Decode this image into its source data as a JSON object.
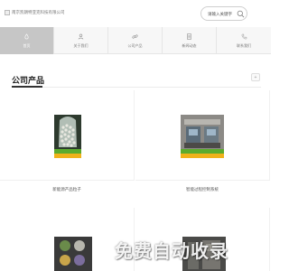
{
  "header": {
    "logo_text": "南京凯朗特亚克科技有限公司",
    "search": {
      "placeholder": "请输入关键字",
      "value": "请输入关键字"
    }
  },
  "nav": {
    "items": [
      {
        "label": "首页",
        "icon": "home-icon",
        "active": true
      },
      {
        "label": "关于我们",
        "icon": "user-icon",
        "active": false
      },
      {
        "label": "公司产品",
        "icon": "link-icon",
        "active": false
      },
      {
        "label": "新闻动态",
        "icon": "document-icon",
        "active": false
      },
      {
        "label": "联系我们",
        "icon": "phone-icon",
        "active": false
      }
    ]
  },
  "products": {
    "title": "公司产品",
    "more_label": "+",
    "items": [
      {
        "caption": "新能源产品粒子"
      },
      {
        "caption": "智能过程控制系统"
      },
      {
        "caption": ""
      },
      {
        "caption": ""
      }
    ]
  },
  "watermark": "免费自动收录",
  "colors": {
    "active_nav": "#c6c6c6",
    "badge_green": "#5cab2e",
    "badge_yellow": "#f0b21a"
  }
}
